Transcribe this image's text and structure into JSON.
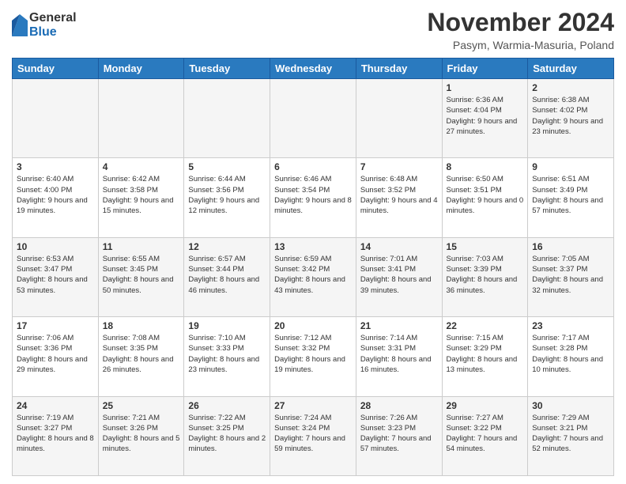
{
  "logo": {
    "general": "General",
    "blue": "Blue"
  },
  "title": "November 2024",
  "subtitle": "Pasym, Warmia-Masuria, Poland",
  "headers": [
    "Sunday",
    "Monday",
    "Tuesday",
    "Wednesday",
    "Thursday",
    "Friday",
    "Saturday"
  ],
  "weeks": [
    [
      {
        "day": "",
        "info": ""
      },
      {
        "day": "",
        "info": ""
      },
      {
        "day": "",
        "info": ""
      },
      {
        "day": "",
        "info": ""
      },
      {
        "day": "",
        "info": ""
      },
      {
        "day": "1",
        "info": "Sunrise: 6:36 AM\nSunset: 4:04 PM\nDaylight: 9 hours and 27 minutes."
      },
      {
        "day": "2",
        "info": "Sunrise: 6:38 AM\nSunset: 4:02 PM\nDaylight: 9 hours and 23 minutes."
      }
    ],
    [
      {
        "day": "3",
        "info": "Sunrise: 6:40 AM\nSunset: 4:00 PM\nDaylight: 9 hours and 19 minutes."
      },
      {
        "day": "4",
        "info": "Sunrise: 6:42 AM\nSunset: 3:58 PM\nDaylight: 9 hours and 15 minutes."
      },
      {
        "day": "5",
        "info": "Sunrise: 6:44 AM\nSunset: 3:56 PM\nDaylight: 9 hours and 12 minutes."
      },
      {
        "day": "6",
        "info": "Sunrise: 6:46 AM\nSunset: 3:54 PM\nDaylight: 9 hours and 8 minutes."
      },
      {
        "day": "7",
        "info": "Sunrise: 6:48 AM\nSunset: 3:52 PM\nDaylight: 9 hours and 4 minutes."
      },
      {
        "day": "8",
        "info": "Sunrise: 6:50 AM\nSunset: 3:51 PM\nDaylight: 9 hours and 0 minutes."
      },
      {
        "day": "9",
        "info": "Sunrise: 6:51 AM\nSunset: 3:49 PM\nDaylight: 8 hours and 57 minutes."
      }
    ],
    [
      {
        "day": "10",
        "info": "Sunrise: 6:53 AM\nSunset: 3:47 PM\nDaylight: 8 hours and 53 minutes."
      },
      {
        "day": "11",
        "info": "Sunrise: 6:55 AM\nSunset: 3:45 PM\nDaylight: 8 hours and 50 minutes."
      },
      {
        "day": "12",
        "info": "Sunrise: 6:57 AM\nSunset: 3:44 PM\nDaylight: 8 hours and 46 minutes."
      },
      {
        "day": "13",
        "info": "Sunrise: 6:59 AM\nSunset: 3:42 PM\nDaylight: 8 hours and 43 minutes."
      },
      {
        "day": "14",
        "info": "Sunrise: 7:01 AM\nSunset: 3:41 PM\nDaylight: 8 hours and 39 minutes."
      },
      {
        "day": "15",
        "info": "Sunrise: 7:03 AM\nSunset: 3:39 PM\nDaylight: 8 hours and 36 minutes."
      },
      {
        "day": "16",
        "info": "Sunrise: 7:05 AM\nSunset: 3:37 PM\nDaylight: 8 hours and 32 minutes."
      }
    ],
    [
      {
        "day": "17",
        "info": "Sunrise: 7:06 AM\nSunset: 3:36 PM\nDaylight: 8 hours and 29 minutes."
      },
      {
        "day": "18",
        "info": "Sunrise: 7:08 AM\nSunset: 3:35 PM\nDaylight: 8 hours and 26 minutes."
      },
      {
        "day": "19",
        "info": "Sunrise: 7:10 AM\nSunset: 3:33 PM\nDaylight: 8 hours and 23 minutes."
      },
      {
        "day": "20",
        "info": "Sunrise: 7:12 AM\nSunset: 3:32 PM\nDaylight: 8 hours and 19 minutes."
      },
      {
        "day": "21",
        "info": "Sunrise: 7:14 AM\nSunset: 3:31 PM\nDaylight: 8 hours and 16 minutes."
      },
      {
        "day": "22",
        "info": "Sunrise: 7:15 AM\nSunset: 3:29 PM\nDaylight: 8 hours and 13 minutes."
      },
      {
        "day": "23",
        "info": "Sunrise: 7:17 AM\nSunset: 3:28 PM\nDaylight: 8 hours and 10 minutes."
      }
    ],
    [
      {
        "day": "24",
        "info": "Sunrise: 7:19 AM\nSunset: 3:27 PM\nDaylight: 8 hours and 8 minutes."
      },
      {
        "day": "25",
        "info": "Sunrise: 7:21 AM\nSunset: 3:26 PM\nDaylight: 8 hours and 5 minutes."
      },
      {
        "day": "26",
        "info": "Sunrise: 7:22 AM\nSunset: 3:25 PM\nDaylight: 8 hours and 2 minutes."
      },
      {
        "day": "27",
        "info": "Sunrise: 7:24 AM\nSunset: 3:24 PM\nDaylight: 7 hours and 59 minutes."
      },
      {
        "day": "28",
        "info": "Sunrise: 7:26 AM\nSunset: 3:23 PM\nDaylight: 7 hours and 57 minutes."
      },
      {
        "day": "29",
        "info": "Sunrise: 7:27 AM\nSunset: 3:22 PM\nDaylight: 7 hours and 54 minutes."
      },
      {
        "day": "30",
        "info": "Sunrise: 7:29 AM\nSunset: 3:21 PM\nDaylight: 7 hours and 52 minutes."
      }
    ]
  ]
}
